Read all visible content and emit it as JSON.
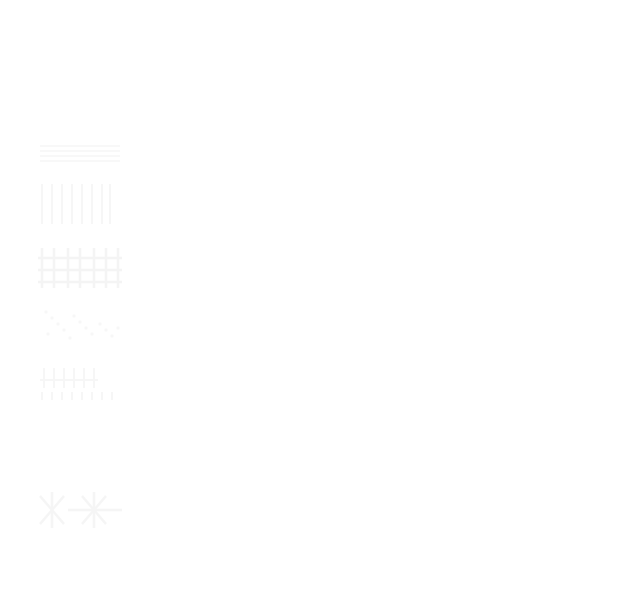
{
  "canvas": {
    "background": "#ffffff"
  },
  "patterns": {
    "stroke_color": "#f2f2f2",
    "items": [
      {
        "name": "horizontal-lines-pattern"
      },
      {
        "name": "vertical-lines-pattern"
      },
      {
        "name": "grid-pattern"
      },
      {
        "name": "diagonal-dots-pattern"
      },
      {
        "name": "picket-pattern"
      },
      {
        "name": "cross-hatch-pattern"
      }
    ]
  }
}
